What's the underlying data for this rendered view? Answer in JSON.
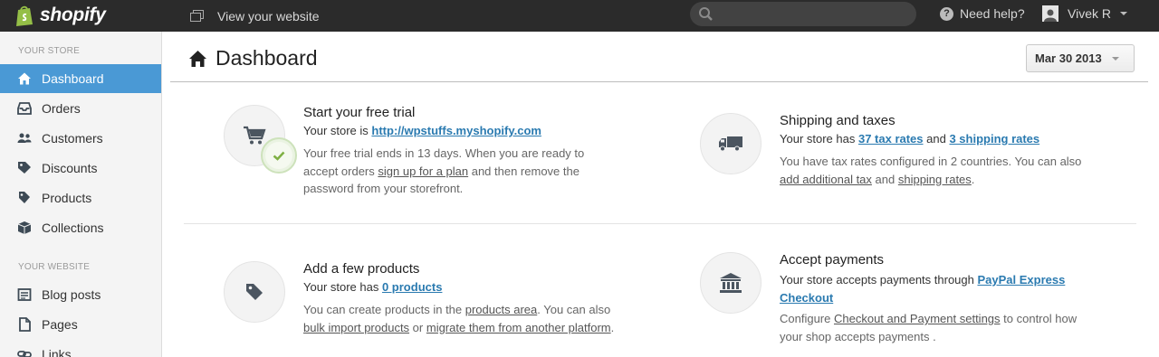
{
  "topbar": {
    "brand": "shopify",
    "view_website": "View your website",
    "search_placeholder": "",
    "help": "Need help?",
    "user_name": "Vivek R"
  },
  "sidebar": {
    "store_section": "YOUR STORE",
    "website_section": "YOUR WEBSITE",
    "items": [
      {
        "label": "Dashboard",
        "icon": "home-icon",
        "active": true
      },
      {
        "label": "Orders",
        "icon": "inbox-icon"
      },
      {
        "label": "Customers",
        "icon": "users-icon"
      },
      {
        "label": "Discounts",
        "icon": "scissors-icon"
      },
      {
        "label": "Products",
        "icon": "tag-icon"
      },
      {
        "label": "Collections",
        "icon": "box-icon"
      },
      {
        "label": "Blog posts",
        "icon": "blog-icon"
      },
      {
        "label": "Pages",
        "icon": "pages-icon"
      },
      {
        "label": "Links",
        "icon": "link-icon"
      }
    ]
  },
  "header": {
    "title": "Dashboard",
    "date": "Mar 30 2013"
  },
  "cards": {
    "trial": {
      "title": "Start your free trial",
      "line_prefix": "Your store is ",
      "store_url": "http://wpstuffs.myshopify.com",
      "desc_1": "Your free trial ends in 13 days. When you are ready to",
      "desc_2a": "accept orders ",
      "desc_2_link": "sign up for a plan",
      "desc_2b": " and then remove the",
      "desc_3": "password from your storefront."
    },
    "shipping": {
      "title": "Shipping and taxes",
      "line_prefix": "Your store has ",
      "tax_link": "37 tax rates",
      "line_mid": " and ",
      "shipping_link": "3 shipping rates",
      "desc_1": "You have tax rates configured in 2 countries. You can also",
      "desc_2_link1": "add additional tax",
      "desc_2_mid": " and ",
      "desc_2_link2": "shipping rates",
      "desc_2_end": "."
    },
    "products": {
      "title": "Add a few products",
      "line_prefix": "Your store has ",
      "products_link": "0 products",
      "desc_1a": "You can create products in the ",
      "desc_1_link": "products area",
      "desc_1b": ". You can also",
      "desc_2_link1": "bulk import products",
      "desc_2_mid": " or ",
      "desc_2_link2": "migrate them from another platform",
      "desc_2_end": "."
    },
    "payments": {
      "title": "Accept payments",
      "line_prefix": "Your store accepts payments through ",
      "paypal_link_1": "PayPal Express",
      "paypal_link_2": "Checkout",
      "desc_1a": "Configure ",
      "desc_1_link": "Checkout and Payment settings",
      "desc_1b": " to control how",
      "desc_2": "your shop accepts payments ."
    }
  },
  "colors": {
    "topbar": "#2b2b2b",
    "active_nav": "#4a99d5",
    "link_blue": "#2a7ab0",
    "brand_green": "#95bf47"
  }
}
